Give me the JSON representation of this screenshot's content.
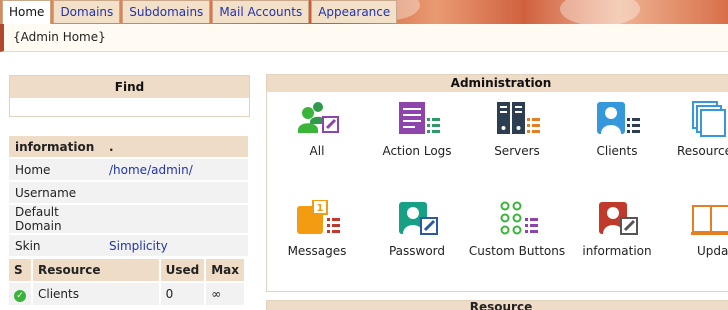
{
  "tabs": [
    {
      "label": "Home",
      "active": true
    },
    {
      "label": "Domains"
    },
    {
      "label": "Subdomains"
    },
    {
      "label": "Mail Accounts"
    },
    {
      "label": "Appearance"
    }
  ],
  "breadcrumb": "{Admin Home}",
  "find": {
    "title": "Find"
  },
  "info": {
    "header": [
      "information",
      "."
    ],
    "rows": [
      {
        "label": "Home",
        "value": "/home/admin/"
      },
      {
        "label": "Username",
        "value": ""
      },
      {
        "label": "Default Domain",
        "value": ""
      },
      {
        "label": "Skin",
        "value": "Simplicity"
      }
    ]
  },
  "resources": {
    "headers": [
      "S",
      "Resource",
      "Used",
      "Max"
    ],
    "rows": [
      {
        "status": "ok",
        "resource": "Clients",
        "used": "0",
        "max": "∞"
      }
    ]
  },
  "admin": {
    "title": "Administration",
    "items": [
      {
        "label": "All",
        "icon": "all-users-icon"
      },
      {
        "label": "Action Logs",
        "icon": "action-logs-icon"
      },
      {
        "label": "Servers",
        "icon": "servers-icon"
      },
      {
        "label": "Clients",
        "icon": "clients-icon"
      },
      {
        "label": "Resources",
        "icon": "resources-icon"
      },
      {
        "label": "Messages",
        "icon": "messages-icon",
        "badge": "1"
      },
      {
        "label": "Password",
        "icon": "password-icon"
      },
      {
        "label": "Custom Buttons",
        "icon": "custom-buttons-icon"
      },
      {
        "label": "information",
        "icon": "information-icon"
      },
      {
        "label": "Update",
        "icon": "update-icon"
      }
    ]
  },
  "resource_panel": {
    "title": "Resource"
  },
  "colors": {
    "accent": "#2233aa",
    "panel_header": "#efdcc7",
    "tab_bg": "#f3e0c9",
    "status_ok": "#3ab53a"
  }
}
